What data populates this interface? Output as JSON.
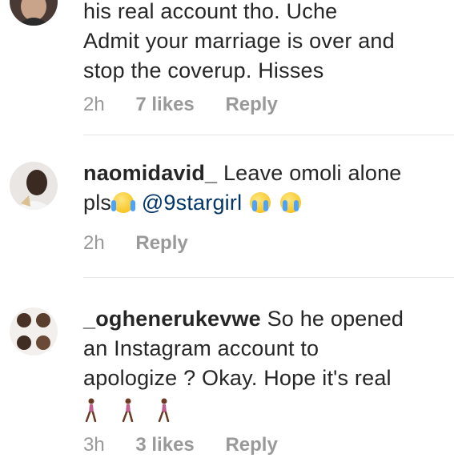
{
  "comments": [
    {
      "username": "",
      "text": "his real account tho. Uche Admit your marriage is over and stop the coverup. Hisses",
      "line1": "his real account tho. Uche",
      "line2": "Admit your marriage is over and",
      "line3": "stop the coverup. Hisses",
      "time": "2h",
      "likes": "7 likes",
      "reply": "Reply"
    },
    {
      "username": "naomidavid_",
      "text_a": "Leave omoli alone",
      "text_b": "pls",
      "mention": "@9stargirl",
      "time": "2h",
      "reply": "Reply"
    },
    {
      "username": "_oghenerukevwe",
      "text_a": "So he opened",
      "text_b": "an Instagram account to",
      "text_c": "apologize ? Okay. Hope it's real",
      "emoji": "woman-walking-icon",
      "time": "3h",
      "likes": "3 likes",
      "reply": "Reply"
    }
  ],
  "colors": {
    "text": "#262626",
    "meta": "#999999",
    "mention": "#003569",
    "divider": "#e6e6e6"
  }
}
